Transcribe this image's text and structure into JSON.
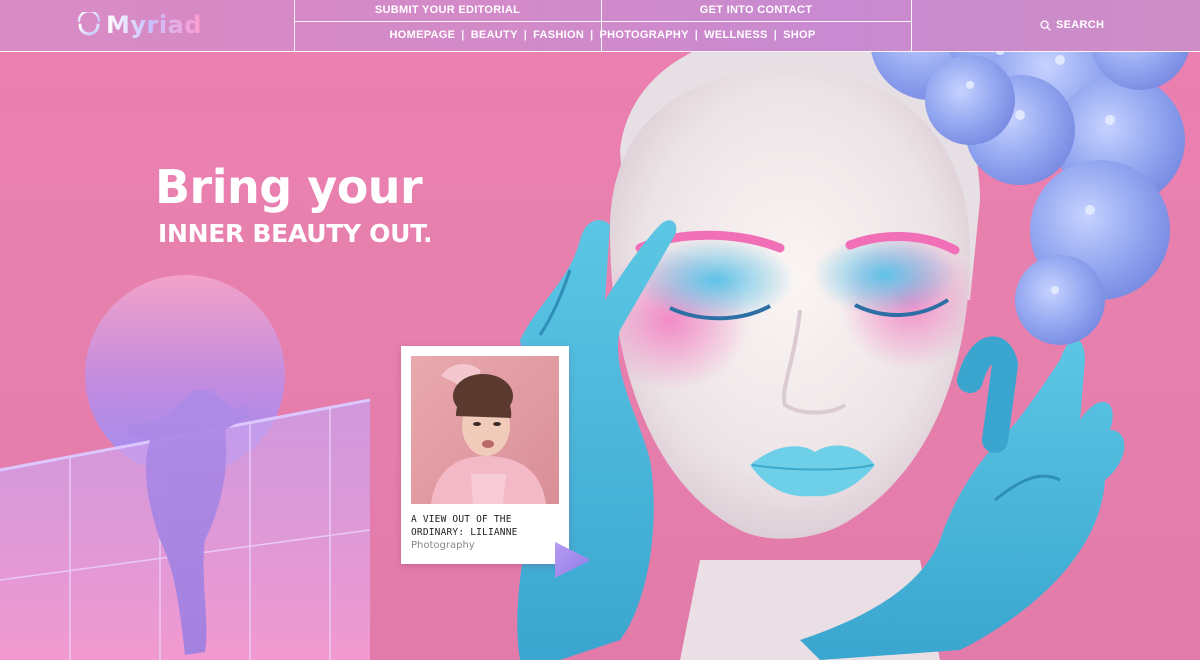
{
  "header": {
    "logo_text": "Myriad",
    "submit_link": "SUBMIT YOUR EDITORIAL",
    "contact_link": "GET INTO CONTACT",
    "nav": [
      "HOMEPAGE",
      "BEAUTY",
      "FASHION",
      "PHOTOGRAPHY",
      "WELLNESS",
      "SHOP"
    ],
    "separator": "|",
    "search_label": "SEARCH",
    "search_icon": "search-icon"
  },
  "hero": {
    "title": "Bring your",
    "subtitle": "INNER BEAUTY OUT."
  },
  "feature_card": {
    "title": "A VIEW OUT OF THE ORDINARY: LILIANNE",
    "category": "Photography",
    "arrow_icon": "play-triangle-icon"
  },
  "colors": {
    "background": "#e880ae",
    "accent_blue": "#4ab3d6",
    "accent_violet": "#9f8cf0"
  }
}
